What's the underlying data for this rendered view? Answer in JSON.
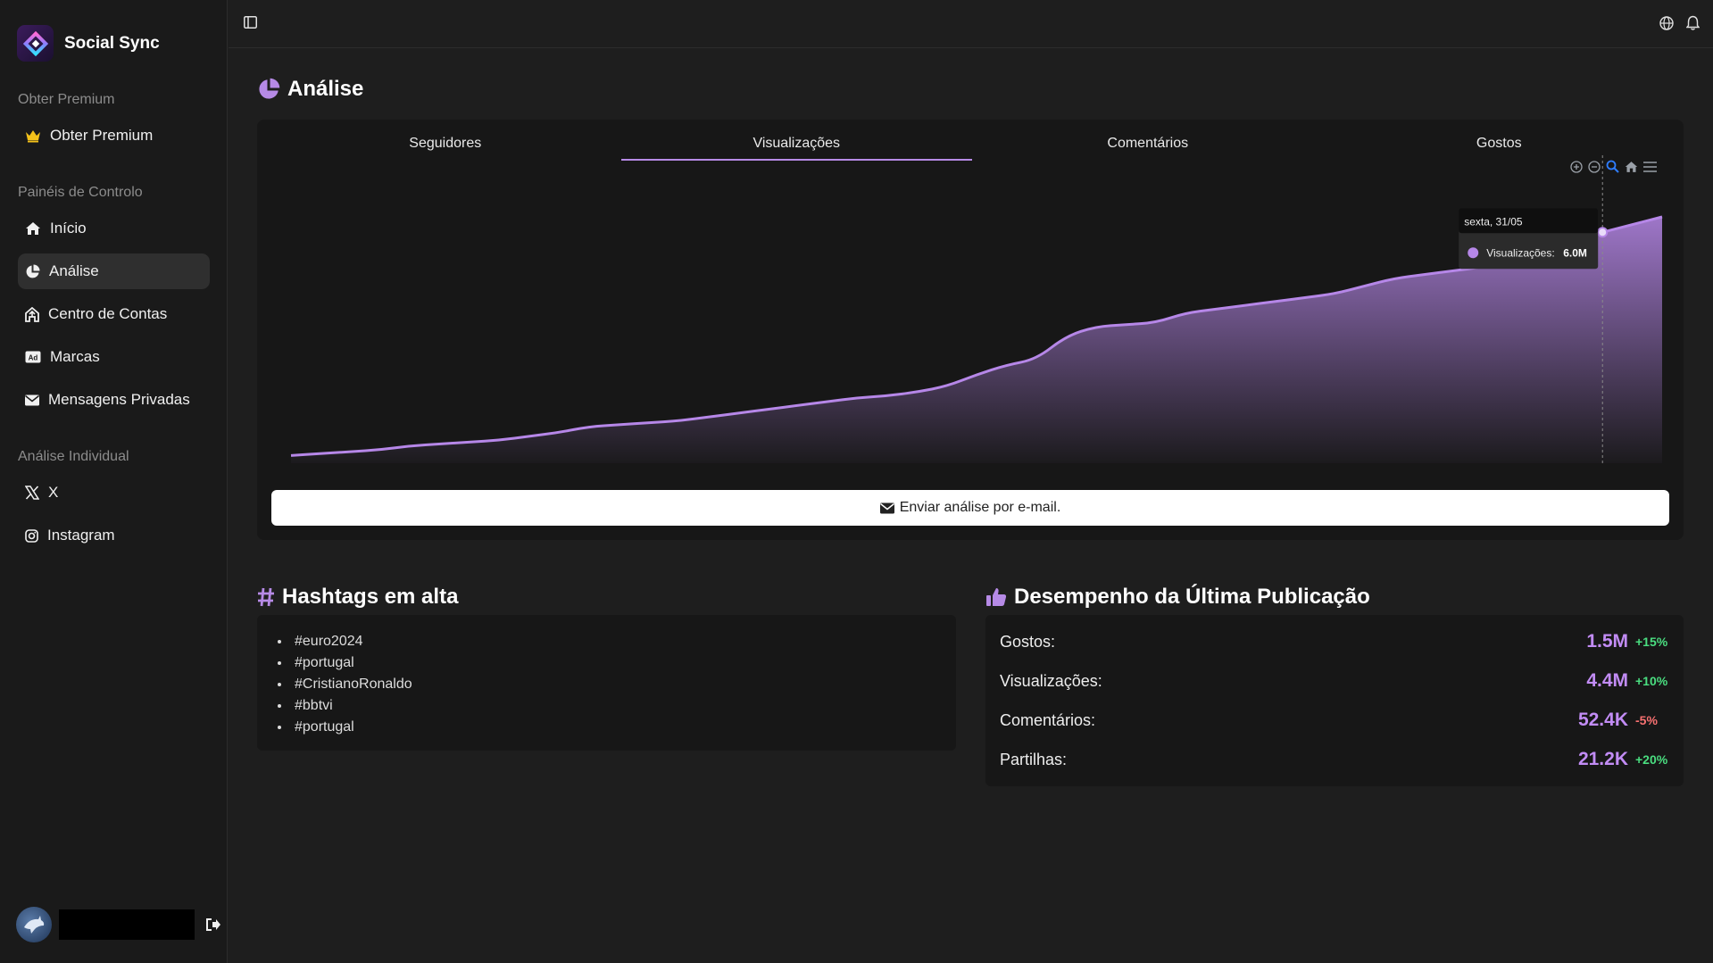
{
  "app": {
    "name": "Social Sync"
  },
  "sidebar": {
    "sections": [
      {
        "label": "Obter Premium"
      },
      {
        "label": "Painéis de Controlo"
      },
      {
        "label": "Análise Individual"
      }
    ],
    "premium": {
      "label": "Obter Premium",
      "icon": "crown-icon"
    },
    "dashboards": [
      {
        "label": "Início",
        "icon": "home-icon"
      },
      {
        "label": "Análise",
        "icon": "pie-chart-icon",
        "active": true
      },
      {
        "label": "Centro de Contas",
        "icon": "account-center-icon"
      },
      {
        "label": "Marcas",
        "icon": "ad-icon"
      },
      {
        "label": "Mensagens Privadas",
        "icon": "envelope-icon"
      }
    ],
    "individual": [
      {
        "label": "X",
        "icon": "x-logo-icon"
      },
      {
        "label": "Instagram",
        "icon": "instagram-icon"
      }
    ]
  },
  "page": {
    "title": "Análise"
  },
  "tabs": [
    {
      "label": "Seguidores"
    },
    {
      "label": "Visualizações",
      "active": true
    },
    {
      "label": "Comentários"
    },
    {
      "label": "Gostos"
    }
  ],
  "chart_data": {
    "type": "area",
    "series": [
      {
        "name": "Visualizações",
        "values": [
          0.2,
          0.25,
          0.3,
          0.35,
          0.45,
          0.5,
          0.55,
          0.6,
          0.7,
          0.8,
          0.95,
          1.0,
          1.05,
          1.1,
          1.2,
          1.3,
          1.4,
          1.5,
          1.6,
          1.7,
          1.75,
          1.85,
          2.0,
          2.3,
          2.55,
          2.7,
          3.3,
          3.55,
          3.6,
          3.65,
          3.9,
          4.0,
          4.1,
          4.2,
          4.3,
          4.4,
          4.6,
          4.8,
          4.9,
          5.0,
          5.1,
          5.3,
          5.5,
          5.8,
          6.0,
          6.2,
          6.4
        ]
      }
    ],
    "color": "#b687e8",
    "ylim": [
      0,
      8
    ],
    "grid": false,
    "legend": "none",
    "tooltip": {
      "title": "sexta, 31/05",
      "series": "Visualizações:",
      "value": "6.0M"
    }
  },
  "email_button": {
    "label": "Enviar análise por e-mail."
  },
  "hashtags": {
    "title": "Hashtags em alta",
    "items": [
      "#euro2024",
      "#portugal",
      "#CristianoRonaldo",
      "#bbtvi",
      "#portugal"
    ]
  },
  "performance": {
    "title": "Desempenho da Última Publicação",
    "rows": [
      {
        "label": "Gostos:",
        "value": "1.5M",
        "change": "+15%"
      },
      {
        "label": "Visualizações:",
        "value": "4.4M",
        "change": "+10%"
      },
      {
        "label": "Comentários:",
        "value": "52.4K",
        "change": "-5%"
      },
      {
        "label": "Partilhas:",
        "value": "21.2K",
        "change": "+20%"
      }
    ]
  },
  "colors": {
    "accent": "#b68ae6",
    "positive": "#4ade80",
    "negative": "#f87171"
  }
}
